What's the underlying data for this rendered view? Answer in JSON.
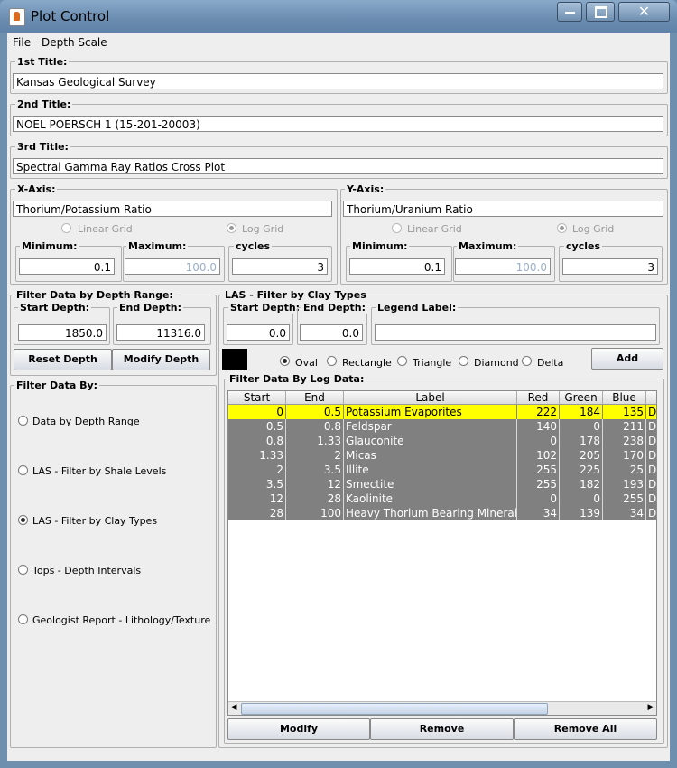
{
  "window": {
    "title": "Plot Control"
  },
  "menu": {
    "file": "File",
    "depth_scale": "Depth Scale"
  },
  "titles": {
    "first_label": "1st Title:",
    "first_value": "Kansas Geological Survey",
    "second_label": "2nd Title:",
    "second_value": "NOEL POERSCH 1 (15-201-20003)",
    "third_label": "3rd Title:",
    "third_value": "Spectral Gamma Ray Ratios Cross Plot"
  },
  "xaxis": {
    "label": "X-Axis:",
    "name": "Thorium/Potassium Ratio",
    "linear": "Linear Grid",
    "log": "Log Grid",
    "min_label": "Minimum:",
    "min": "0.1",
    "max_label": "Maximum:",
    "max": "100.0",
    "cycles_label": "cycles",
    "cycles": "3"
  },
  "yaxis": {
    "label": "Y-Axis:",
    "name": "Thorium/Uranium Ratio",
    "linear": "Linear Grid",
    "log": "Log Grid",
    "min_label": "Minimum:",
    "min": "0.1",
    "max_label": "Maximum:",
    "max": "100.0",
    "cycles_label": "cycles",
    "cycles": "3"
  },
  "depth_filter": {
    "label": "Filter Data by Depth Range:",
    "start_label": "Start Depth:",
    "start": "1850.0",
    "end_label": "End Depth:",
    "end": "11316.0",
    "reset": "Reset Depth",
    "modify": "Modify Depth"
  },
  "filter_by": {
    "label": "Filter Data By:",
    "options": [
      "Data by Depth Range",
      "LAS - Filter by Shale Levels",
      "LAS - Filter by Clay Types",
      "Tops - Depth Intervals",
      "Geologist Report - Lithology/Texture"
    ]
  },
  "clay": {
    "label": "LAS - Filter by Clay Types",
    "start_label": "Start Depth:",
    "start": "0.0",
    "end_label": "End Depth:",
    "end": "0.0",
    "legend_label": "Legend Label:",
    "legend_value": "",
    "swatch_color": "#000000",
    "shapes": [
      "Oval",
      "Rectangle",
      "Triangle",
      "Diamond",
      "Delta"
    ],
    "add": "Add"
  },
  "log_filter": {
    "label": "Filter Data By Log Data:",
    "columns": [
      "Start",
      "End",
      "Label",
      "Red",
      "Green",
      "Blue",
      ""
    ],
    "rows": [
      [
        "0",
        "0.5",
        "Potassium Evaporites",
        "222",
        "184",
        "135",
        "D"
      ],
      [
        "0.5",
        "0.8",
        "Feldspar",
        "140",
        "0",
        "211",
        "D"
      ],
      [
        "0.8",
        "1.33",
        "Glauconite",
        "0",
        "178",
        "238",
        "D"
      ],
      [
        "1.33",
        "2",
        "Micas",
        "102",
        "205",
        "170",
        "D"
      ],
      [
        "2",
        "3.5",
        "Illite",
        "255",
        "225",
        "25",
        "D"
      ],
      [
        "3.5",
        "12",
        "Smectite",
        "255",
        "182",
        "193",
        "D"
      ],
      [
        "12",
        "28",
        "Kaolinite",
        "0",
        "0",
        "255",
        "D"
      ],
      [
        "28",
        "100",
        "Heavy Thorium Bearing Minerals",
        "34",
        "139",
        "34",
        "D"
      ]
    ],
    "modify": "Modify",
    "remove": "Remove",
    "remove_all": "Remove All"
  },
  "colors": {
    "selected_row": "#ffff00",
    "row_bg": "#808080",
    "title_bar": "#6a8cb0"
  }
}
